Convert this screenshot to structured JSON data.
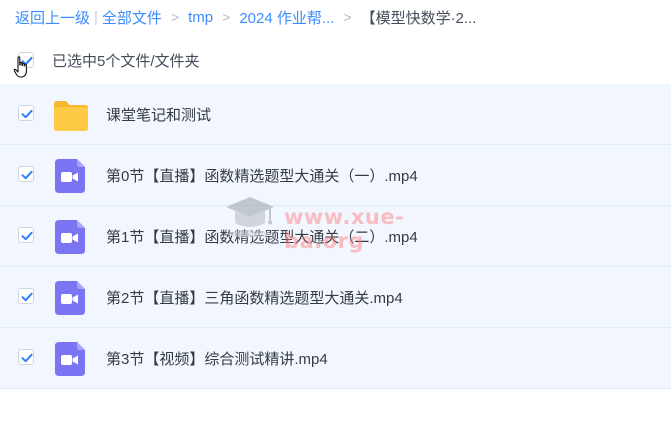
{
  "breadcrumb": {
    "back": "返回上一级",
    "pipe": "|",
    "items": [
      "全部文件",
      "tmp",
      "2024 作业帮..."
    ],
    "separator": ">",
    "current": "【模型快数学·2..."
  },
  "selection": {
    "label": "已选中5个文件/文件夹",
    "checked": true
  },
  "files": [
    {
      "name": "课堂笔记和测试",
      "type": "folder",
      "icon": "folder-icon",
      "checked": true
    },
    {
      "name": "第0节【直播】函数精选题型大通关（一）.mp4",
      "type": "video",
      "icon": "video-file-icon",
      "checked": true
    },
    {
      "name": "第1节【直播】函数精选题型大通关（二）.mp4",
      "type": "video",
      "icon": "video-file-icon",
      "checked": true
    },
    {
      "name": "第2节【直播】三角函数精选题型大通关.mp4",
      "type": "video",
      "icon": "video-file-icon",
      "checked": true
    },
    {
      "name": "第3节【视频】综合测试精讲.mp4",
      "type": "video",
      "icon": "video-file-icon",
      "checked": true
    }
  ],
  "watermark": {
    "text": "www.xue-ba.org"
  },
  "colors": {
    "link": "#3b8cff",
    "row_bg": "#f2f7ff",
    "checkbox": "#2e7ff5",
    "folder": "#ffcb45",
    "video": "#7b74f3",
    "watermark": "#ff7777"
  }
}
